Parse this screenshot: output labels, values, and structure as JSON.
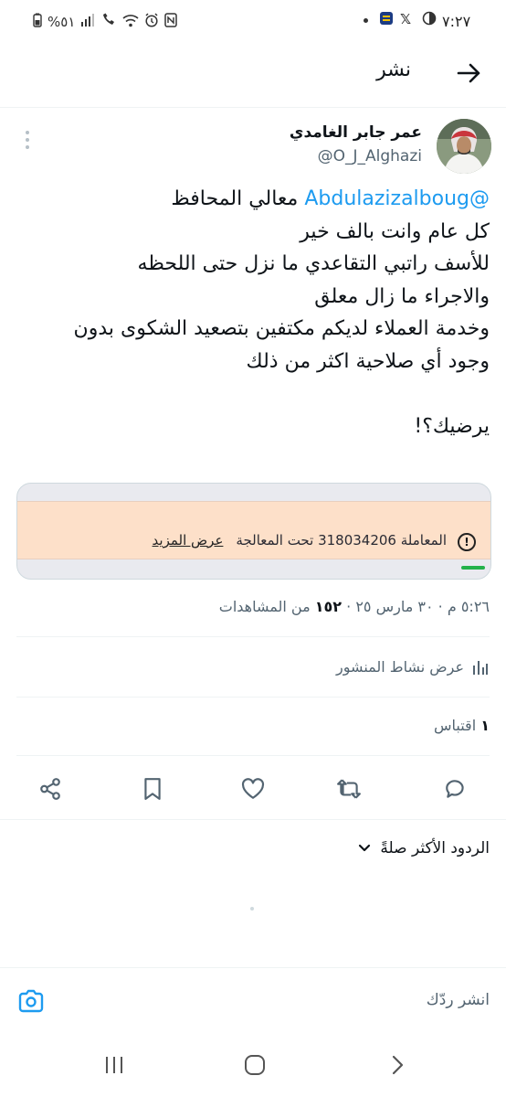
{
  "status_bar": {
    "time": "٧:٢٧",
    "battery": "%٥١",
    "left_icons": [
      "battery-icon",
      "signal-icon",
      "wifi-call-icon",
      "wifi-icon",
      "alarm-icon",
      "nfc-icon"
    ],
    "right_icons": [
      "dark-mode-icon",
      "x-app-icon",
      "bank-app-icon",
      "notification-dot-icon"
    ]
  },
  "header": {
    "title": "نشر",
    "back_icon": "arrow-right-icon"
  },
  "post": {
    "author_name": "عمر جابر الغامدي",
    "author_handle": "@O_J_Alghazi",
    "mention": "@Abdulazizalboug",
    "text_after_mention": "معالي المحافظ",
    "body": "كل عام وانت بالف خير\nللأسف راتبي التقاعدي ما نزل حتى اللحظه\nوالاجراء ما زال معلق\nوخدمة العملاء لديكم مكتفين بتصعيد الشكوى بدون\nوجود أي صلاحية اكثر من ذلك\n\nيرضيك؟!",
    "media": {
      "alert_text": "المعاملة 318034206 تحت المعالجة",
      "link_text": "عرض المزيد",
      "alert_icon": "exclamation-circle-icon"
    },
    "time": "٥:٢٦ م",
    "date": "٣٠ مارس ٢٥",
    "views_count": "١٥٢",
    "views_label": "من المشاهدات",
    "activity_label": "عرض نشاط المنشور",
    "quotes_count": "١",
    "quotes_label": "اقتباس"
  },
  "actions": {
    "icons": [
      "reply-icon",
      "repost-icon",
      "like-icon",
      "bookmark-icon",
      "share-icon"
    ]
  },
  "replies": {
    "sort_label": "الردود الأكثر صلةً"
  },
  "composer": {
    "placeholder": "انشر ردّك"
  },
  "colors": {
    "accent": "#1d9bf0",
    "alert_background": "#fde0c9",
    "progress": "#24b24a"
  }
}
